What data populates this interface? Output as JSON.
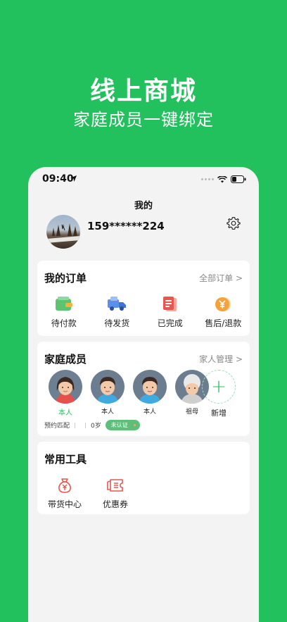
{
  "promo": {
    "headline": "线上商城",
    "subline": "家庭成员一键绑定"
  },
  "status_bar": {
    "time": "09:40"
  },
  "page": {
    "title": "我的"
  },
  "profile": {
    "phone": "159******224"
  },
  "orders": {
    "title": "我的订单",
    "all_link": "全部订单 >",
    "items": [
      {
        "label": "待付款",
        "icon": "wallet-icon"
      },
      {
        "label": "待发货",
        "icon": "truck-icon"
      },
      {
        "label": "已完成",
        "icon": "document-icon"
      },
      {
        "label": "售后/退款",
        "icon": "coin-icon"
      }
    ]
  },
  "family": {
    "title": "家庭成员",
    "manage_link": "家人管理 >",
    "members": [
      {
        "name": "本人",
        "active": true
      },
      {
        "name": "本人"
      },
      {
        "name": "本人"
      },
      {
        "name": "祖母"
      }
    ],
    "add_label": "新增",
    "info": {
      "match": "预约匹配",
      "age": "0岁",
      "badge": "未认证"
    }
  },
  "tools": {
    "title": "常用工具",
    "items": [
      {
        "label": "带货中心",
        "icon": "money-bag-icon"
      },
      {
        "label": "优惠券",
        "icon": "coupon-icon"
      }
    ]
  },
  "colors": {
    "brand_green": "#22c15e",
    "background": "#f3f3f3"
  }
}
